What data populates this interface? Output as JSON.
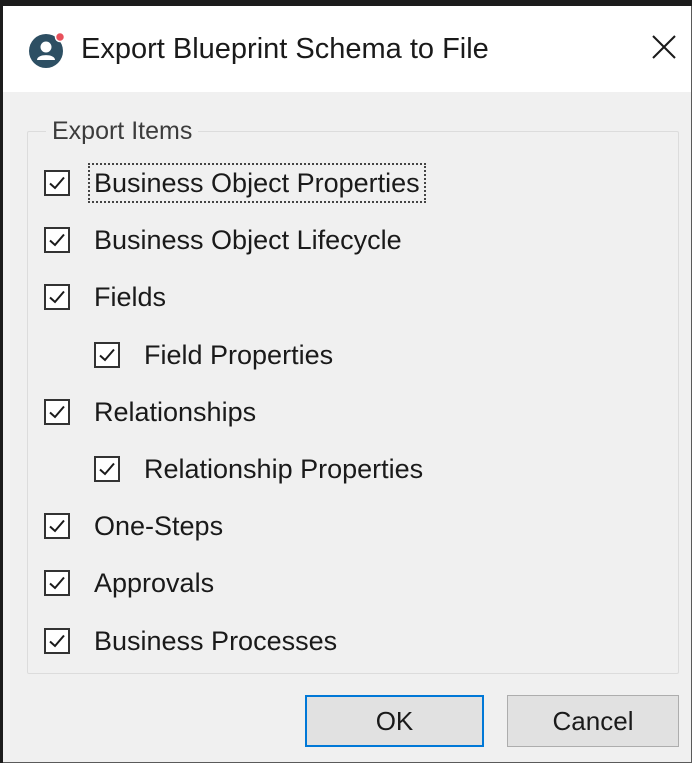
{
  "window": {
    "title": "Export Blueprint Schema to File",
    "app_icon": "user-person-icon",
    "close_icon": "close-icon",
    "close_glyph": "✕"
  },
  "export_group": {
    "title": "Export Items",
    "items": [
      {
        "label": "Business Object Properties",
        "checked": true,
        "indent": 0,
        "focused": true
      },
      {
        "label": "Business Object Lifecycle",
        "checked": true,
        "indent": 0,
        "focused": false
      },
      {
        "label": "Fields",
        "checked": true,
        "indent": 0,
        "focused": false
      },
      {
        "label": "Field Properties",
        "checked": true,
        "indent": 1,
        "focused": false
      },
      {
        "label": "Relationships",
        "checked": true,
        "indent": 0,
        "focused": false
      },
      {
        "label": "Relationship Properties",
        "checked": true,
        "indent": 1,
        "focused": false
      },
      {
        "label": "One-Steps",
        "checked": true,
        "indent": 0,
        "focused": false
      },
      {
        "label": "Approvals",
        "checked": true,
        "indent": 0,
        "focused": false
      },
      {
        "label": "Business Processes",
        "checked": true,
        "indent": 0,
        "focused": false
      }
    ]
  },
  "buttons": {
    "ok_label": "OK",
    "cancel_label": "Cancel"
  },
  "colors": {
    "default_button_border": "#0078d7",
    "dialog_background": "#f0f0f0",
    "icon_color": "#2d4f63"
  }
}
